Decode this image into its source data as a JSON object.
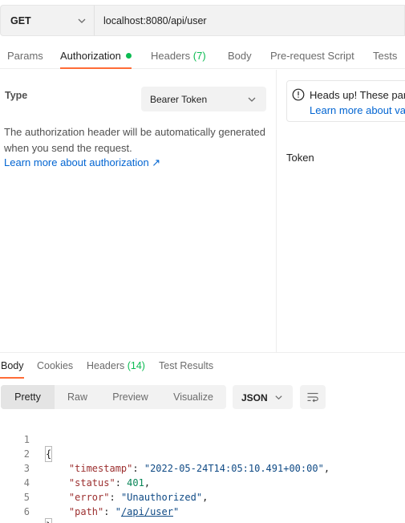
{
  "request": {
    "method": "GET",
    "url": "localhost:8080/api/user"
  },
  "request_tabs": [
    {
      "label": "Params"
    },
    {
      "label": "Authorization",
      "active": true
    },
    {
      "label": "Headers",
      "count": "(7)"
    },
    {
      "label": "Body"
    },
    {
      "label": "Pre-request Script"
    },
    {
      "label": "Tests"
    }
  ],
  "auth": {
    "type_label": "Type",
    "type_value": "Bearer Token",
    "description": "The authorization header will be automatically generated when you send the request.",
    "learn_link": "Learn more about authorization ↗"
  },
  "notice": {
    "icon": "info-icon",
    "title": "Heads up! These para",
    "link": "Learn more about var"
  },
  "token": {
    "label": "Token"
  },
  "response_tabs": [
    {
      "label": "Body",
      "active": true
    },
    {
      "label": "Cookies"
    },
    {
      "label": "Headers",
      "count": "(14)"
    },
    {
      "label": "Test Results"
    }
  ],
  "view_modes": [
    "Pretty",
    "Raw",
    "Preview",
    "Visualize"
  ],
  "format": "JSON",
  "code": {
    "line_numbers": [
      "1",
      "2",
      "3",
      "4",
      "5",
      "6"
    ],
    "open_brace": "{",
    "close_brace": "}",
    "fields": [
      {
        "key": "\"timestamp\"",
        "value": "\"2022-05-24T14:05:10.491+00:00\"",
        "suffix": ","
      },
      {
        "key": "\"status\"",
        "value": "401",
        "suffix": ","
      },
      {
        "key": "\"error\"",
        "value": "\"Unauthorized\"",
        "suffix": ","
      },
      {
        "key": "\"path\"",
        "value_prefix": "\"",
        "value": "/api/user",
        "value_suffix": "\"",
        "suffix": ""
      }
    ]
  },
  "colors": {
    "accent": "#ff6c37",
    "link": "#0265d2",
    "green": "#0cbb52"
  }
}
